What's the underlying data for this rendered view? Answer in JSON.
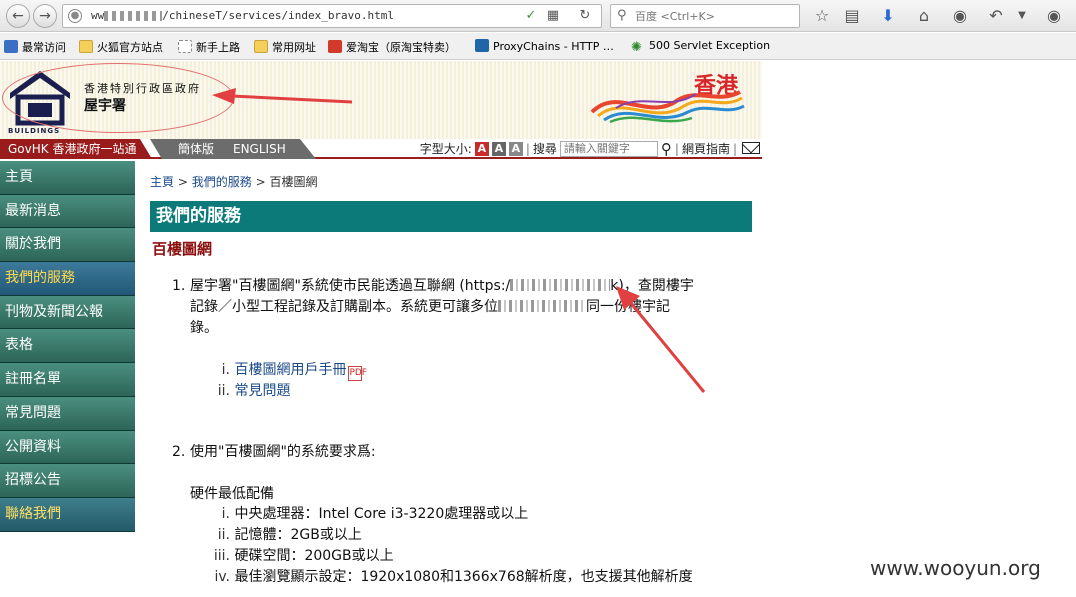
{
  "browser": {
    "url_prefix": "ww",
    "url_suffix": "/chineseT/services/index_bravo.html",
    "search_placeholder": "百度 <Ctrl+K>"
  },
  "bookmarks": [
    {
      "label": "最常访问",
      "icon": "blue"
    },
    {
      "label": "火狐官方站点",
      "icon": "folder"
    },
    {
      "label": "新手上路",
      "icon": "page"
    },
    {
      "label": "常用网址",
      "icon": "folder"
    },
    {
      "label": "爱淘宝（原淘宝特卖）",
      "icon": "red"
    },
    {
      "label": "ProxyChains - HTTP …",
      "icon": "proxy"
    },
    {
      "label": "500 Servlet Exception",
      "icon": "green"
    }
  ],
  "header": {
    "logo_text": "BUILDINGS",
    "gov_title": "香港特別行政區政府",
    "dept_title": "屋宇署",
    "hk_word": "香港"
  },
  "nav": {
    "govhk": "GovHK 香港政府一站通",
    "lang_simplified": "簡体版",
    "lang_english": "ENGLISH",
    "font_size_label": "字型大小:",
    "font_buttons": [
      "A",
      "A",
      "A"
    ],
    "search_label": "搜尋",
    "search_placeholder": "請輸入關鍵字",
    "sitemap_label": "網頁指南"
  },
  "sidebar": {
    "items": [
      {
        "label": "主頁"
      },
      {
        "label": "最新消息"
      },
      {
        "label": "關於我們"
      },
      {
        "label": "我們的服務"
      },
      {
        "label": "刊物及新聞公報"
      },
      {
        "label": "表格"
      },
      {
        "label": "註冊名單"
      },
      {
        "label": "常見問題"
      },
      {
        "label": "公開資料"
      },
      {
        "label": "招標公告"
      },
      {
        "label": "聯絡我們"
      }
    ]
  },
  "main": {
    "breadcrumb": {
      "home": "主頁",
      "sep": ">",
      "services": "我們的服務",
      "current": "百樓圖網"
    },
    "section_title": "我們的服務",
    "subtitle": "百樓圖網",
    "item1": {
      "num": "1.",
      "text_a": "屋宇署\"百樓圖網\"系統使市民能透過互聯網 (https:/",
      "text_b": "k)，查閱樓宇",
      "line2_a": "記錄／小型工程記錄及訂購副本。系統更可讓多位",
      "line2_b": "同一份樓宇記",
      "line3": "錄。"
    },
    "sublinks": [
      {
        "num": "i.",
        "label": "百樓圖網用戶手冊"
      },
      {
        "num": "ii.",
        "label": "常見問題"
      }
    ],
    "pdf_icon_text": "PDF",
    "item2": {
      "num": "2.",
      "text": "使用\"百樓圖網\"的系統要求爲:"
    },
    "hardware_title": "硬件最低配備",
    "hardware": [
      {
        "num": "i.",
        "text": "中央處理器：Intel Core i3-3220處理器或以上"
      },
      {
        "num": "ii.",
        "text": "記憶體：2GB或以上"
      },
      {
        "num": "iii.",
        "text": "硬碟空間：200GB或以上"
      },
      {
        "num": "iv.",
        "text": "最佳瀏覽顯示設定：1920x1080和1366x768解析度，也支援其他解析度"
      }
    ]
  },
  "watermark": "www.wooyun.org",
  "colors": {
    "teal_bar": "#0b7a78",
    "dark_red": "#9a1b1b",
    "subtitle_red": "#8e1111",
    "annotation_red": "#e04040"
  }
}
